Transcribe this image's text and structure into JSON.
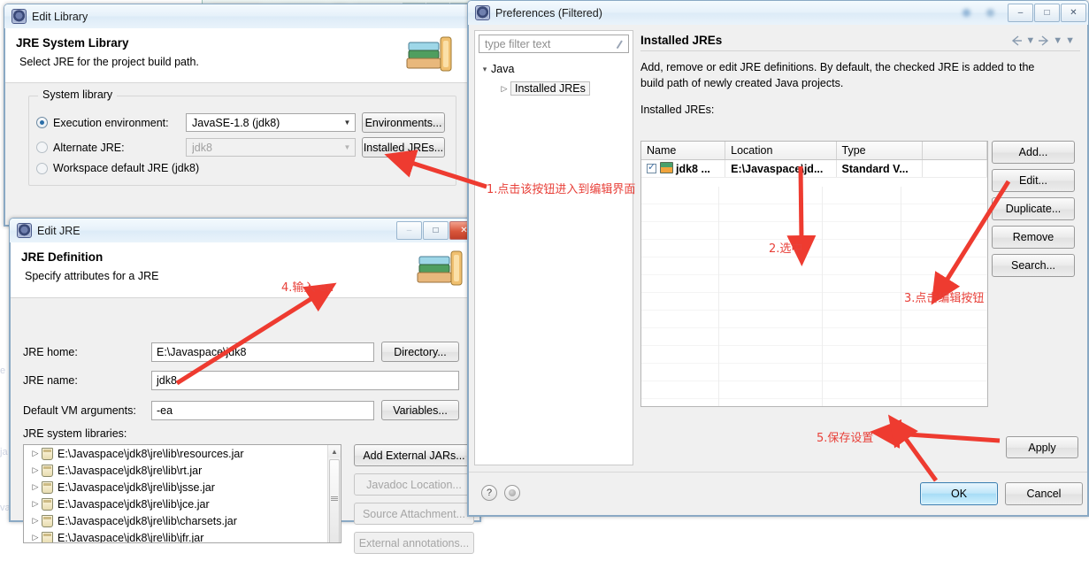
{
  "background_window": {
    "title_blurred": true
  },
  "edit_library": {
    "title": "Edit Library",
    "header_title": "JRE System Library",
    "header_subtitle": "Select JRE for the project build path.",
    "group_title": "System library",
    "options": [
      {
        "label": "Execution environment:",
        "selected": true,
        "value": "JavaSE-1.8 (jdk8)",
        "button": "Environments...",
        "enabled": true
      },
      {
        "label": "Alternate JRE:",
        "selected": false,
        "value": "jdk8",
        "button": "Installed JREs...",
        "enabled": false
      },
      {
        "label": "Workspace default JRE (jdk8)",
        "selected": false
      }
    ],
    "win_buttons": {
      "minimize": "–",
      "maximize": "□",
      "close": "✕"
    }
  },
  "edit_jre": {
    "title": "Edit JRE",
    "header_title": "JRE Definition",
    "header_subtitle": "Specify attributes for a JRE",
    "fields": [
      {
        "label": "JRE home:",
        "value": "E:\\Javaspace\\jdk8",
        "button": "Directory...",
        "button_enabled": true
      },
      {
        "label": "JRE name:",
        "value": "jdk8",
        "button": "",
        "button_enabled": true
      },
      {
        "label": "Default VM arguments:",
        "value": "-ea",
        "button": "Variables...",
        "button_enabled": true
      }
    ],
    "libraries_label": "JRE system libraries:",
    "libraries": [
      "E:\\Javaspace\\jdk8\\jre\\lib\\resources.jar",
      "E:\\Javaspace\\jdk8\\jre\\lib\\rt.jar",
      "E:\\Javaspace\\jdk8\\jre\\lib\\jsse.jar",
      "E:\\Javaspace\\jdk8\\jre\\lib\\jce.jar",
      "E:\\Javaspace\\jdk8\\jre\\lib\\charsets.jar",
      "E:\\Javaspace\\jdk8\\jre\\lib\\jfr.jar"
    ],
    "side_buttons": [
      {
        "label": "Add External JARs...",
        "enabled": true
      },
      {
        "label": "Javadoc Location...",
        "enabled": false
      },
      {
        "label": "Source Attachment...",
        "enabled": false
      },
      {
        "label": "External annotations...",
        "enabled": false
      }
    ],
    "win_buttons": {
      "minimize": "–",
      "maximize": "□",
      "close": "✕"
    }
  },
  "preferences": {
    "title": "Preferences (Filtered)",
    "filter_placeholder": "type filter text",
    "tree": [
      {
        "label": "Java",
        "level": 0,
        "expanded": true,
        "selected": false
      },
      {
        "label": "Installed JREs",
        "level": 1,
        "expanded": false,
        "selected": true
      }
    ],
    "page_title": "Installed JREs",
    "description": "Add, remove or edit JRE definitions. By default, the checked JRE is added to the build path of newly created Java projects.",
    "table_label": "Installed JREs:",
    "table": {
      "columns": [
        "Name",
        "Location",
        "Type",
        ""
      ],
      "rows": [
        {
          "checked": true,
          "name": "jdk8 ...",
          "location": "E:\\Javaspace\\jd...",
          "type": "Standard V...",
          "extra": ""
        }
      ]
    },
    "side_buttons": [
      {
        "label": "Add...",
        "enabled": true
      },
      {
        "label": "Edit...",
        "enabled": true
      },
      {
        "label": "Duplicate...",
        "enabled": true
      },
      {
        "label": "Remove",
        "enabled": true
      },
      {
        "label": "Search...",
        "enabled": true
      }
    ],
    "apply_label": "Apply",
    "ok_label": "OK",
    "cancel_label": "Cancel",
    "help_glyph": "?",
    "win_buttons": {
      "minimize": "–",
      "maximize": "□",
      "close": "✕"
    }
  },
  "annotations": [
    {
      "id": 1,
      "text": "1.点击该按钮进入到编辑界面"
    },
    {
      "id": 2,
      "text": "2.选中"
    },
    {
      "id": 3,
      "text": "3.点击编辑按钮"
    },
    {
      "id": 4,
      "text": "4.输入-ea"
    },
    {
      "id": 5,
      "text": "5.保存设置"
    }
  ],
  "colors": {
    "annotation": "#e8413a",
    "primary_button": "#a6dcf6",
    "close_button": "#c03f2a"
  }
}
